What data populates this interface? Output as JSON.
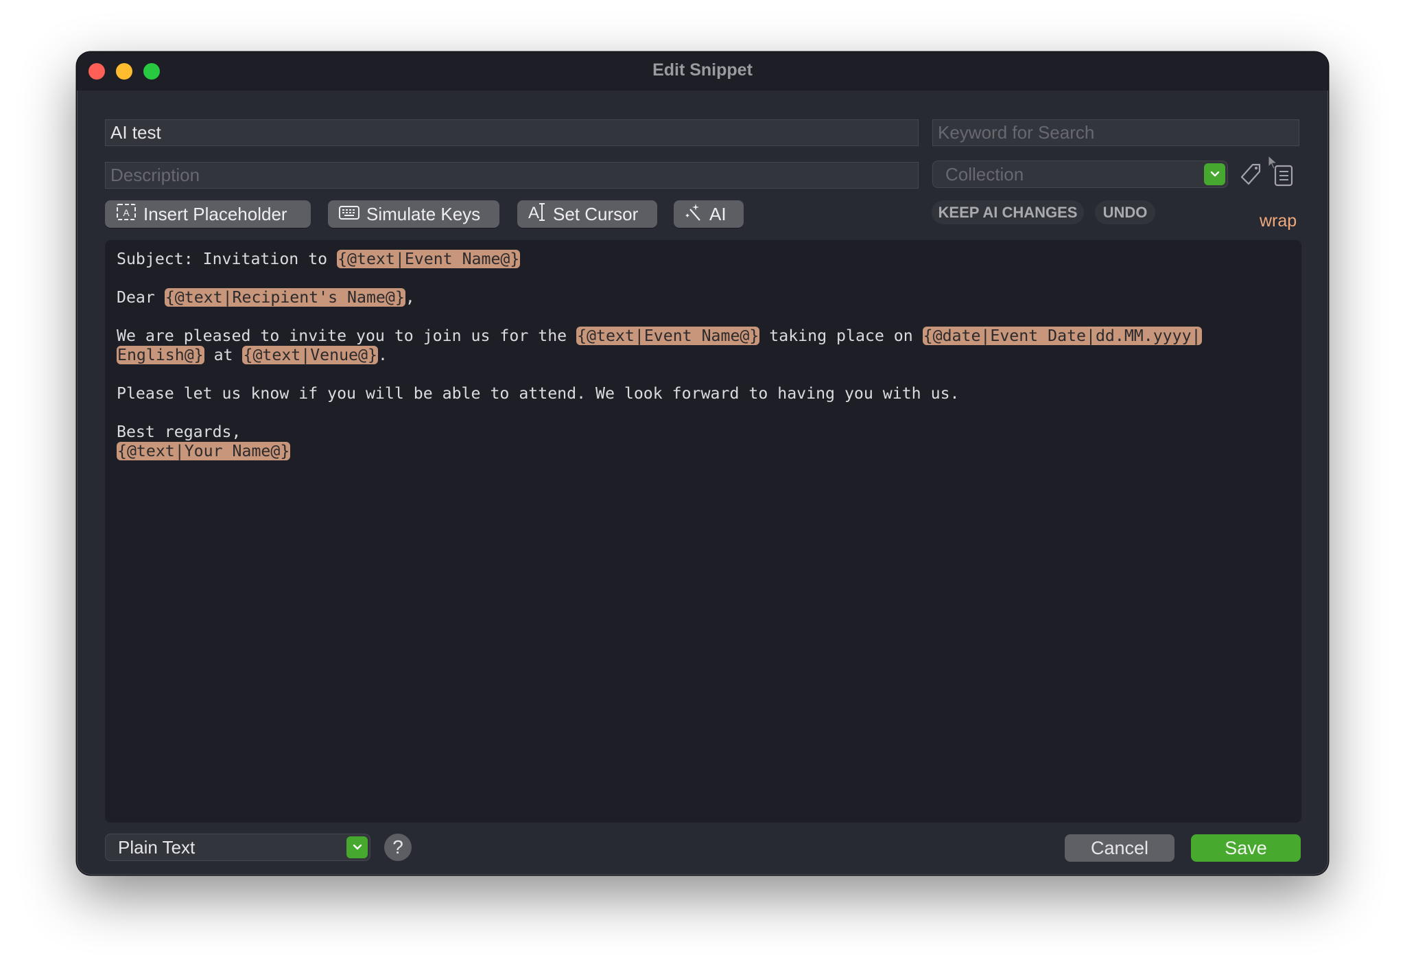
{
  "window": {
    "title": "Edit Snippet",
    "traffic_lights": [
      "close",
      "minimize",
      "maximize"
    ]
  },
  "fields": {
    "name_value": "AI test",
    "keyword_placeholder": "Keyword for Search",
    "description_placeholder": "Description",
    "collection_placeholder": "Collection"
  },
  "toolbar": {
    "insert_placeholder": "Insert Placeholder",
    "simulate_keys": "Simulate Keys",
    "set_cursor": "Set Cursor",
    "ai": "AI",
    "keep_ai_changes": "KEEP AI CHANGES",
    "undo": "UNDO",
    "wrap": "wrap"
  },
  "editor": {
    "lines": [
      [
        {
          "t": "Subject: Invitation to "
        },
        {
          "c": "{@text|Event Name@}"
        }
      ],
      [],
      [
        {
          "t": "Dear "
        },
        {
          "c": "{@text|Recipient's Name@}"
        },
        {
          "t": ","
        }
      ],
      [],
      [
        {
          "t": "We are pleased to invite you to join us for the "
        },
        {
          "c": "{@text|Event Name@}"
        },
        {
          "t": " taking place on "
        },
        {
          "c": "{@date|Event Date|dd.MM.yyyy|"
        }
      ],
      [
        {
          "c": "English@}"
        },
        {
          "t": " at "
        },
        {
          "c": "{@text|Venue@}"
        },
        {
          "t": "."
        }
      ],
      [],
      [
        {
          "t": "Please let us know if you will be able to attend. We look forward to having you with us."
        }
      ],
      [],
      [
        {
          "t": "Best regards,"
        }
      ],
      [
        {
          "c": "{@text|Your Name@}"
        }
      ]
    ]
  },
  "footer": {
    "format_value": "Plain Text",
    "help_label": "?",
    "cancel_label": "Cancel",
    "save_label": "Save"
  },
  "colors": {
    "accent_green": "#47aa2f",
    "placeholder_chip": "#c8967a",
    "wrap_link": "#efa97c"
  }
}
